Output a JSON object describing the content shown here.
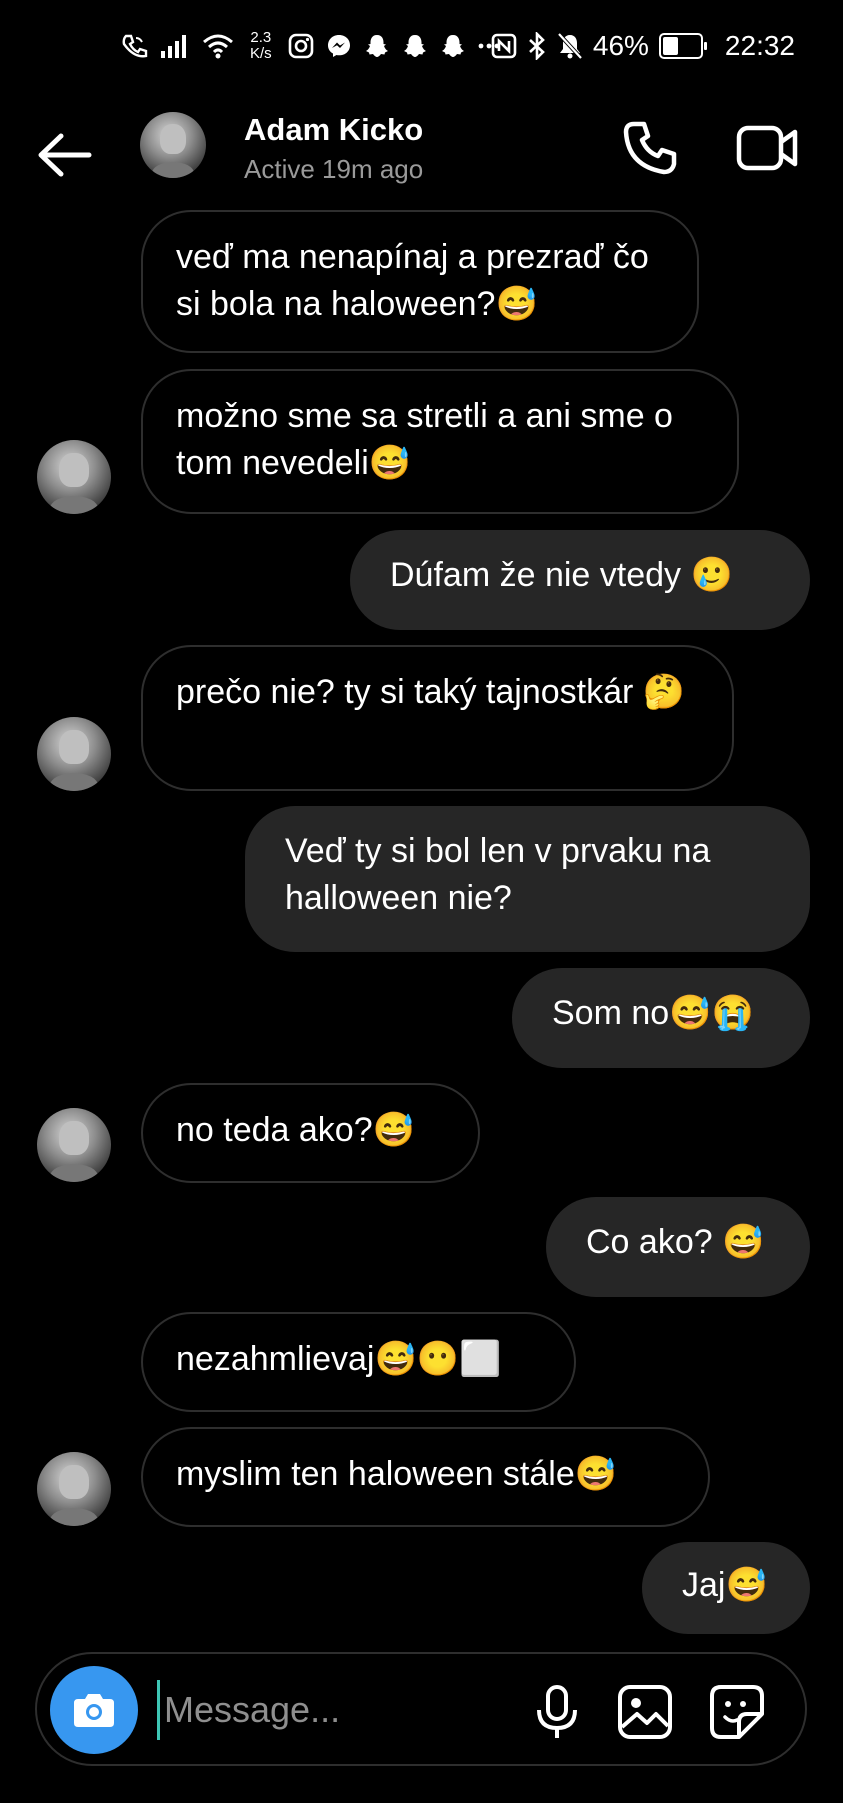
{
  "status_bar": {
    "speed_value": "2.3",
    "speed_unit": "K/s",
    "battery": "46%",
    "battery_level": 0.46,
    "time": "22:32",
    "icons": [
      "wifi-calling-icon",
      "signal-icon",
      "wifi-icon",
      "instagram-icon",
      "messenger-icon",
      "snapchat-icon",
      "snapchat-icon",
      "snapchat-icon",
      "more-icon",
      "nfc-icon",
      "bluetooth-icon",
      "mute-icon",
      "battery-icon"
    ]
  },
  "header": {
    "name": "Adam Kicko",
    "status": "Active 19m ago"
  },
  "messages": [
    {
      "side": "in",
      "text": "veď ma nenapínaj a prezraď čo si bola na haloween?😅",
      "avatar": false
    },
    {
      "side": "in",
      "text": "možno sme sa stretli a ani sme o tom nevedeli😅",
      "avatar": true
    },
    {
      "side": "out",
      "text": "Dúfam že nie vtedy 🥲"
    },
    {
      "side": "in",
      "text": "prečo nie? ty si taký tajnostkár 🤔",
      "avatar": true
    },
    {
      "side": "out",
      "text": "Veď ty si bol len v prvaku na halloween nie?"
    },
    {
      "side": "out",
      "text": "Som no😅😭"
    },
    {
      "side": "in",
      "text": "no teda ako?😅",
      "avatar": true
    },
    {
      "side": "out",
      "text": "Co ako? 😅"
    },
    {
      "side": "in",
      "text": "nezahmlievaj😅😶⬜",
      "avatar": false
    },
    {
      "side": "in",
      "text": "myslim ten haloween stále😅",
      "avatar": true
    },
    {
      "side": "out",
      "text": "Jaj😅"
    }
  ],
  "composer": {
    "placeholder": "Message..."
  },
  "colors": {
    "background": "#000000",
    "outgoing_bubble": "#262626",
    "incoming_border": "#2e2e2e",
    "accent": "#3797f0",
    "muted_text": "#9a9a9a"
  }
}
